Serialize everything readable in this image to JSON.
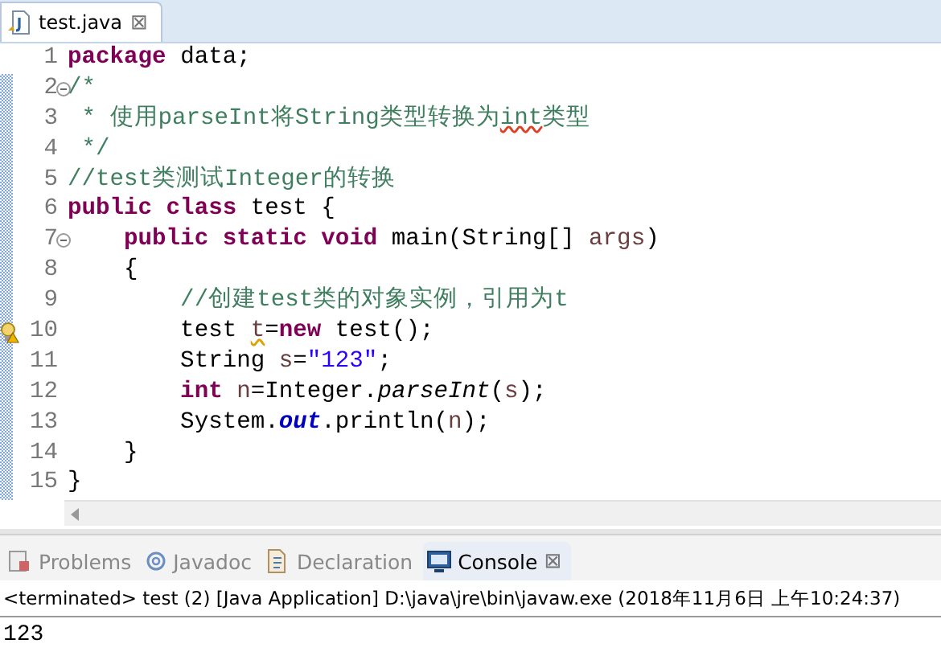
{
  "editor_tabs": [
    {
      "label": "test.java",
      "selected": true,
      "close": "⊠"
    }
  ],
  "code_lines": [
    {
      "number": "1",
      "kind": "plain",
      "tokens": [
        {
          "t": "package",
          "kind": "kw"
        },
        {
          "t": " data;",
          "kind": "plain"
        }
      ]
    },
    {
      "number": "2",
      "kind": "fold",
      "tokens": [
        {
          "t": "/*",
          "kind": "comment"
        }
      ]
    },
    {
      "number": "3",
      "kind": "plain",
      "tokens": [
        {
          "t": " * 使用parseInt将String类型转换为",
          "kind": "comment"
        },
        {
          "t": "int",
          "kind": "comment-flagged"
        },
        {
          "t": "类型",
          "kind": "comment"
        }
      ]
    },
    {
      "number": "4",
      "kind": "plain",
      "tokens": [
        {
          "t": " */",
          "kind": "comment"
        }
      ]
    },
    {
      "number": "5",
      "kind": "plain",
      "tokens": [
        {
          "t": "//test类测试Integer的转换",
          "kind": "comment"
        }
      ]
    },
    {
      "number": "6",
      "kind": "plain",
      "tokens": [
        {
          "t": "public class",
          "kind": "kw"
        },
        {
          "t": " test {",
          "kind": "plain"
        }
      ]
    },
    {
      "number": "7",
      "kind": "fold",
      "tokens": [
        {
          "t": "    public static void",
          "kind": "kw"
        },
        {
          "t": " main(String[] ",
          "kind": "plain"
        },
        {
          "t": "args",
          "kind": "var"
        },
        {
          "t": ")",
          "kind": "plain"
        }
      ]
    },
    {
      "number": "8",
      "kind": "plain",
      "tokens": [
        {
          "t": "    {",
          "kind": "plain"
        }
      ]
    },
    {
      "number": "9",
      "kind": "plain",
      "tokens": [
        {
          "t": "        //创建test类的对象实例，引用为t",
          "kind": "comment"
        }
      ]
    },
    {
      "number": "10",
      "kind": "warning",
      "tokens": [
        {
          "t": "        test ",
          "kind": "plain"
        },
        {
          "t": "t",
          "kind": "var-flagged"
        },
        {
          "t": "=",
          "kind": "plain"
        },
        {
          "t": "new",
          "kind": "kw"
        },
        {
          "t": " test();",
          "kind": "plain"
        }
      ]
    },
    {
      "number": "11",
      "kind": "plain",
      "tokens": [
        {
          "t": "        String ",
          "kind": "plain"
        },
        {
          "t": "s",
          "kind": "var"
        },
        {
          "t": "=",
          "kind": "plain"
        },
        {
          "t": "\"123\"",
          "kind": "string"
        },
        {
          "t": ";",
          "kind": "plain"
        }
      ]
    },
    {
      "number": "12",
      "kind": "plain",
      "tokens": [
        {
          "t": "        int",
          "kind": "kw"
        },
        {
          "t": " n",
          "kind": "var"
        },
        {
          "t": "=Integer.",
          "kind": "plain"
        },
        {
          "t": "parseInt",
          "kind": "method"
        },
        {
          "t": "(",
          "kind": "plain"
        },
        {
          "t": "s",
          "kind": "var"
        },
        {
          "t": ");",
          "kind": "plain"
        }
      ]
    },
    {
      "number": "13",
      "kind": "plain",
      "tokens": [
        {
          "t": "        System.",
          "kind": "plain"
        },
        {
          "t": "out",
          "kind": "field"
        },
        {
          "t": ".println(",
          "kind": "plain"
        },
        {
          "t": "n",
          "kind": "var"
        },
        {
          "t": ");",
          "kind": "plain"
        }
      ]
    },
    {
      "number": "14",
      "kind": "plain",
      "tokens": [
        {
          "t": "    }",
          "kind": "plain"
        }
      ]
    },
    {
      "number": "15",
      "kind": "plain",
      "tokens": [
        {
          "t": "}",
          "kind": "plain"
        }
      ]
    }
  ],
  "panel_tabs": [
    {
      "label": "Problems",
      "kind": "problems",
      "selected": false
    },
    {
      "label": "Javadoc",
      "kind": "javadoc",
      "selected": false
    },
    {
      "label": "Declaration",
      "kind": "declaration",
      "selected": false
    },
    {
      "label": "Console",
      "kind": "console",
      "selected": true,
      "close": "⊠"
    }
  ],
  "console": {
    "status": "<terminated> test (2) [Java Application] D:\\java\\jre\\bin\\javaw.exe (2018年11月6日 上午10:24:37)",
    "output": "123"
  }
}
